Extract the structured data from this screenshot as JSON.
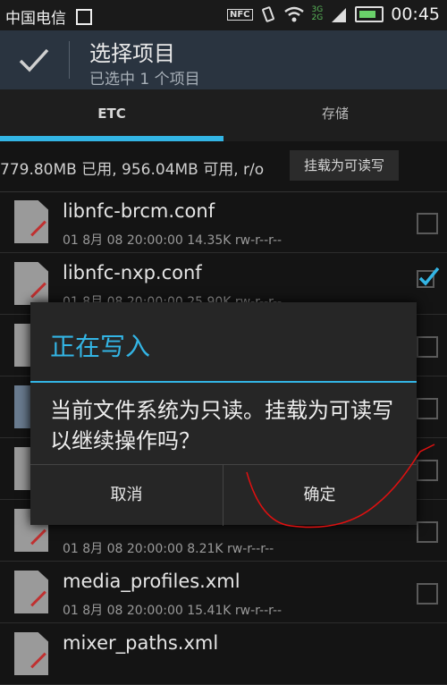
{
  "status_bar": {
    "carrier": "中国电信",
    "nfc": "NFC",
    "network_top": "3G",
    "network_bottom": "2G",
    "time": "00:45"
  },
  "action_bar": {
    "title": "选择项目",
    "subtitle": "已选中 1 个项目"
  },
  "tabs": [
    {
      "label": "ETC",
      "active": true
    },
    {
      "label": "存储",
      "active": false
    }
  ],
  "storage": {
    "info": "779.80MB 已用, 956.04MB 可用, r/o",
    "mount_button": "挂载为可读写"
  },
  "files": [
    {
      "name": "libnfc-brcm.conf",
      "meta": "01 8月 08 20:00:00  14.35K  rw-r--r--",
      "checked": false
    },
    {
      "name": "libnfc-nxp.conf",
      "meta": "01 8月 08 20:00:00  25.90K  rw-r--r--",
      "checked": true
    },
    {
      "name": "",
      "meta": "",
      "checked": false
    },
    {
      "name": "",
      "meta": "",
      "checked": false
    },
    {
      "name": "",
      "meta": "",
      "checked": false
    },
    {
      "name": "",
      "meta": "01 8月 08 20:00:00  8.21K  rw-r--r--",
      "checked": false
    },
    {
      "name": "media_profiles.xml",
      "meta": "01 8月 08 20:00:00  15.41K  rw-r--r--",
      "checked": false
    },
    {
      "name": "mixer_paths.xml",
      "meta": "",
      "checked": false
    }
  ],
  "dialog": {
    "title": "正在写入",
    "message": "当前文件系统为只读。挂载为可读写以继续操作吗？",
    "cancel": "取消",
    "confirm": "确定"
  },
  "colors": {
    "accent": "#33b5e5",
    "action_bar": "#2a3440",
    "annotation": "#e01010"
  }
}
